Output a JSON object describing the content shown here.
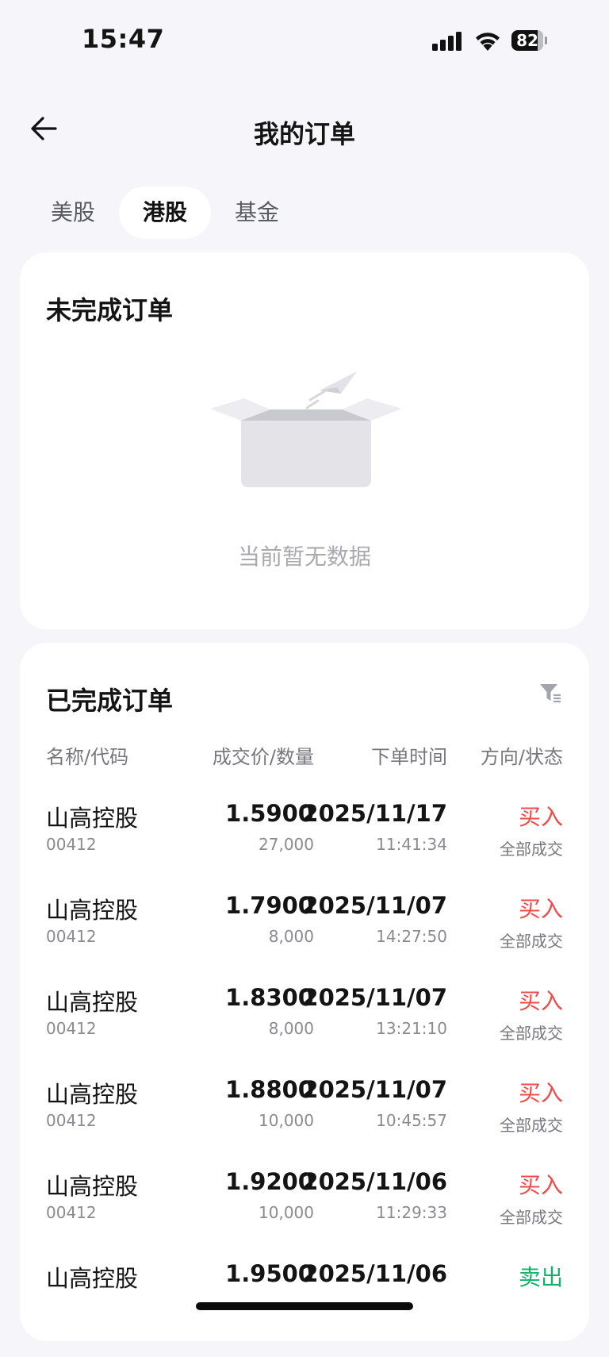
{
  "status_bar": {
    "time": "15:47",
    "battery": "82"
  },
  "header": {
    "title": "我的订单"
  },
  "tabs": [
    {
      "label": "美股",
      "active": false
    },
    {
      "label": "港股",
      "active": true
    },
    {
      "label": "基金",
      "active": false
    }
  ],
  "pending": {
    "title": "未完成订单",
    "empty_text": "当前暂无数据"
  },
  "completed": {
    "title": "已完成订单",
    "columns": [
      "名称/代码",
      "成交价/数量",
      "下单时间",
      "方向/状态"
    ],
    "rows": [
      {
        "name": "山高控股",
        "code": "00412",
        "price": "1.5900",
        "qty": "27,000",
        "date": "2025/11/17",
        "time": "11:41:34",
        "direction": "买入",
        "status": "全部成交"
      },
      {
        "name": "山高控股",
        "code": "00412",
        "price": "1.7900",
        "qty": "8,000",
        "date": "2025/11/07",
        "time": "14:27:50",
        "direction": "买入",
        "status": "全部成交"
      },
      {
        "name": "山高控股",
        "code": "00412",
        "price": "1.8300",
        "qty": "8,000",
        "date": "2025/11/07",
        "time": "13:21:10",
        "direction": "买入",
        "status": "全部成交"
      },
      {
        "name": "山高控股",
        "code": "00412",
        "price": "1.8800",
        "qty": "10,000",
        "date": "2025/11/07",
        "time": "10:45:57",
        "direction": "买入",
        "status": "全部成交"
      },
      {
        "name": "山高控股",
        "code": "00412",
        "price": "1.9200",
        "qty": "10,000",
        "date": "2025/11/06",
        "time": "11:29:33",
        "direction": "买入",
        "status": "全部成交"
      },
      {
        "name": "山高控股",
        "code": "",
        "price": "1.9500",
        "qty": "",
        "date": "2025/11/06",
        "time": "",
        "direction": "卖出",
        "status": ""
      }
    ]
  },
  "colors": {
    "buy": "#ef4b4b",
    "sell": "#13b36b",
    "background": "#f5f5fa"
  },
  "icons": {
    "back": "arrow-left-icon",
    "filter": "filter-icon",
    "empty": "empty-box-icon"
  }
}
